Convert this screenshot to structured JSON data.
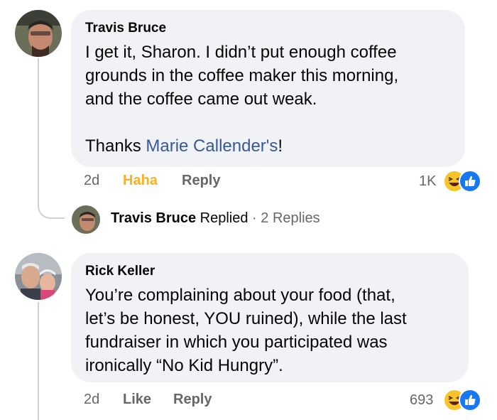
{
  "comments": [
    {
      "author": "Travis Bruce",
      "lines": [
        "I get it, Sharon.  I didn’t put enough coffee",
        "grounds in the coffee maker this morning,",
        "and the coffee came out weak."
      ],
      "thanks_prefix": "Thanks ",
      "thanks_link": "Marie Callender's",
      "thanks_suffix": "!",
      "time": "2d",
      "reaction_action": "Haha",
      "reply_label": "Reply",
      "reaction_count": "1K",
      "reaction_icons": [
        "haha-icon",
        "like-icon"
      ]
    },
    {
      "author": "Rick Keller",
      "lines": [
        "You’re complaining about your food (that,",
        "let’s be honest, YOU ruined), while the last",
        "fundraiser in which you participated was",
        "ironically “No Kid Hungry”."
      ],
      "time": "2d",
      "reaction_action": "Like",
      "reply_label": "Reply",
      "reaction_count": "693",
      "reaction_icons": [
        "haha-icon",
        "like-icon"
      ]
    }
  ],
  "replies_summary": {
    "name": "Travis Bruce",
    "action": "Replied",
    "dot": "·",
    "count": "2 Replies"
  },
  "colors": {
    "bubble": "#f0f2f5",
    "link": "#385898",
    "haha": "#f7b125",
    "meta": "#65676b",
    "like_blue": "#1877f2"
  }
}
